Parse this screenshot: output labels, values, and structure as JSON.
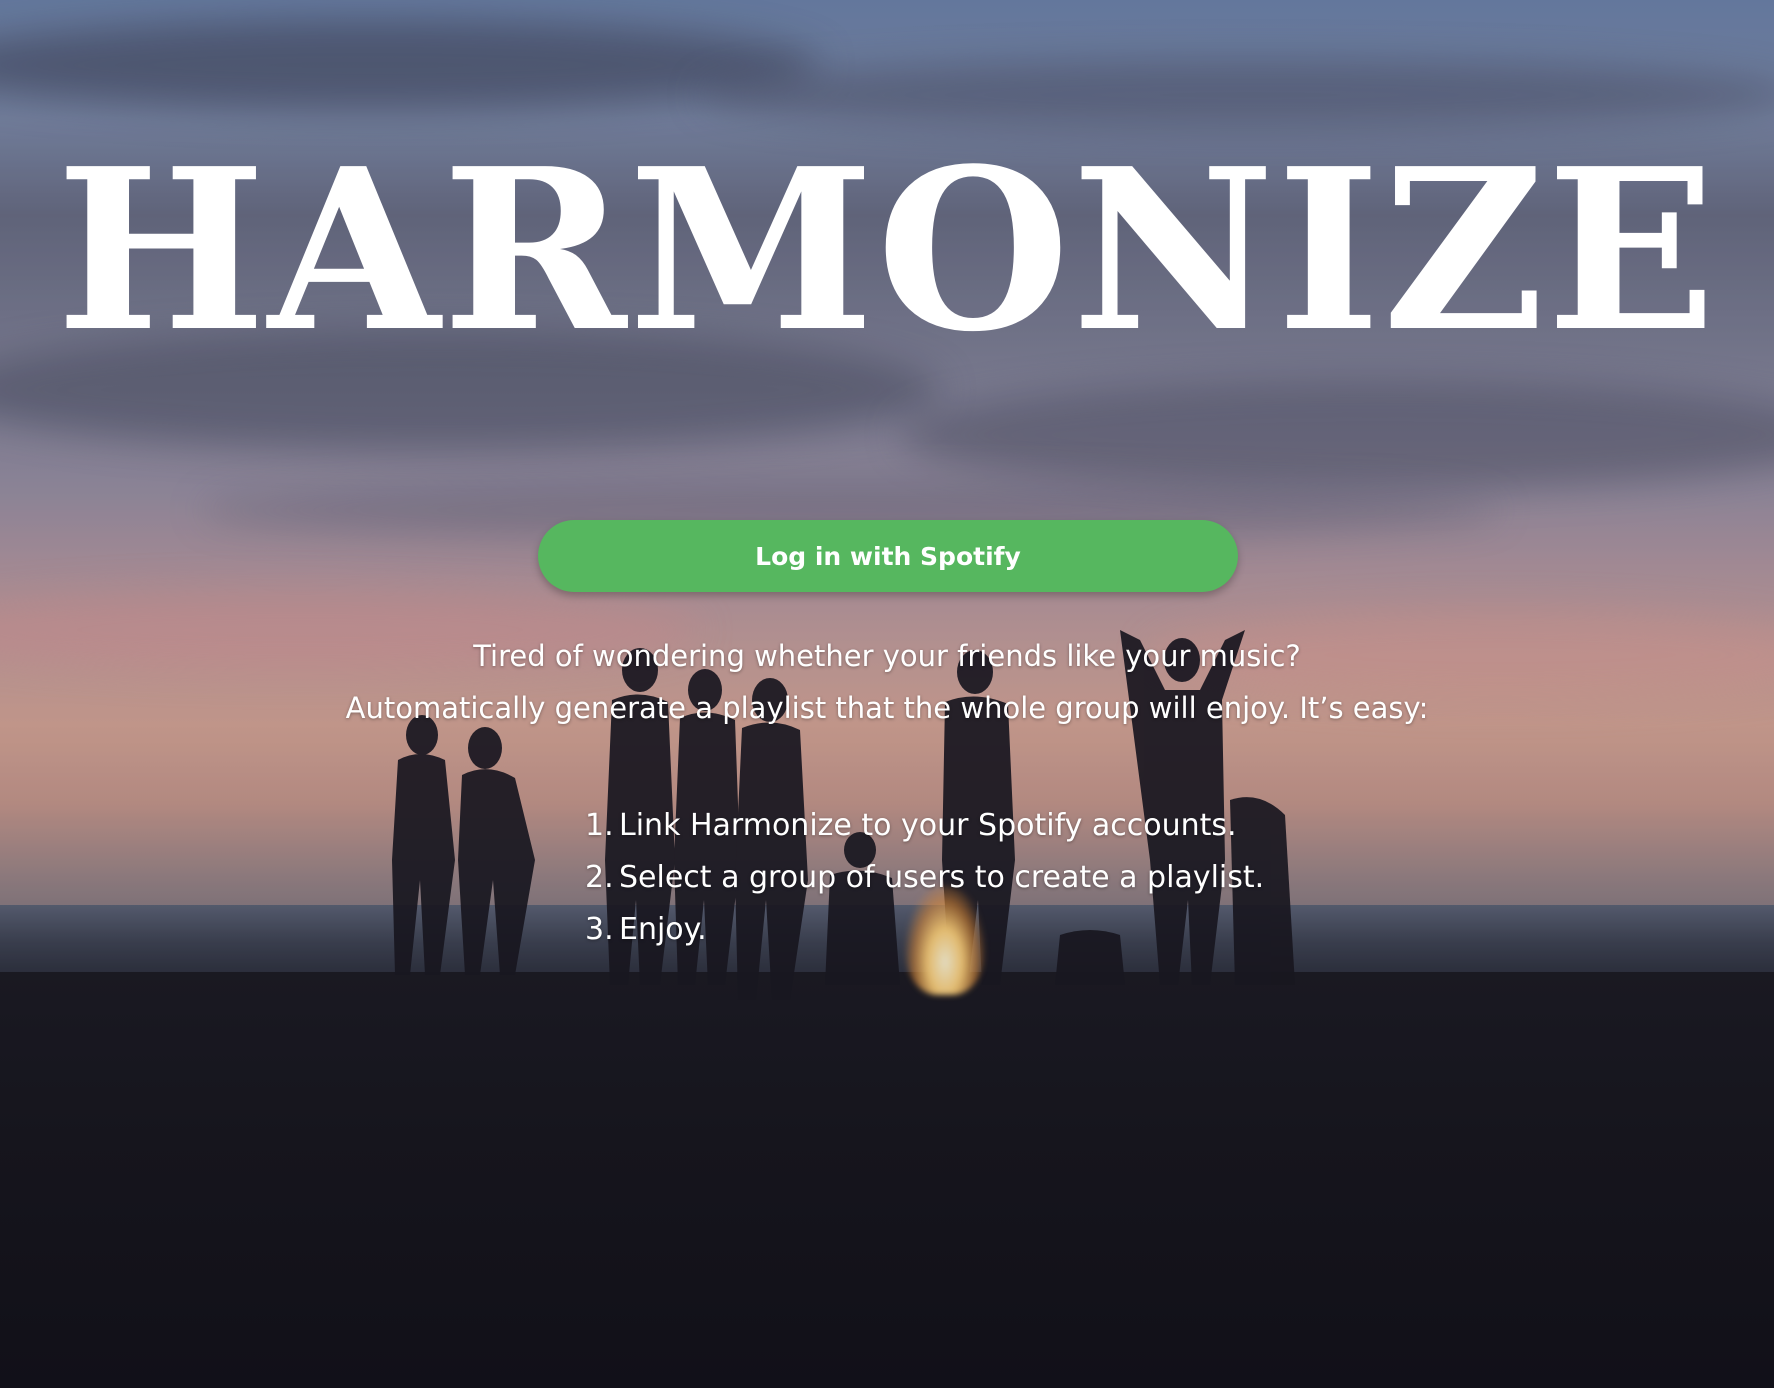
{
  "app": {
    "title": "HARMONIZE"
  },
  "auth": {
    "login_label": "Log in with Spotify",
    "button_color": "#56b75f"
  },
  "intro": {
    "line1": "Tired of wondering whether your friends like your music?",
    "line2": "Automatically generate a playlist that the whole group will enjoy. It’s easy:"
  },
  "steps": [
    {
      "num": "1.",
      "text": "Link Harmonize to your Spotify accounts."
    },
    {
      "num": "2.",
      "text": "Select a group of users to create a playlist."
    },
    {
      "num": "3.",
      "text": "Enjoy."
    }
  ],
  "background": {
    "scene": "beach-bonfire-at-sunset-photo"
  }
}
